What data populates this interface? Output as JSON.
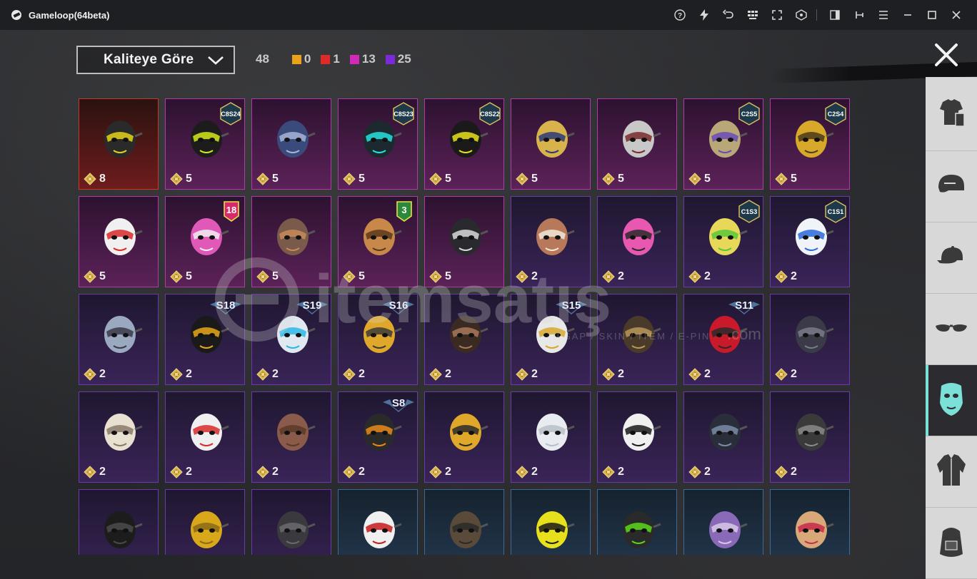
{
  "window": {
    "title": "Gameloop(64beta)"
  },
  "titlebar_icons": [
    "help-icon",
    "flash-icon",
    "undo-icon",
    "keyboard-icon",
    "fullscreen-icon",
    "gyro-icon",
    "sidebar-toggle-icon",
    "pin-icon",
    "menu-icon",
    "minimize-icon",
    "maximize-icon",
    "close-window-icon"
  ],
  "toolbar": {
    "sort_label": "Kaliteye Göre",
    "total_count": "48",
    "counts": [
      {
        "value": "0",
        "color": "#e9a21a"
      },
      {
        "value": "1",
        "color": "#e02a2a"
      },
      {
        "value": "13",
        "color": "#d12ab8"
      },
      {
        "value": "25",
        "color": "#7a2ad8"
      }
    ]
  },
  "colors": {
    "accent": "#7ae0d8",
    "legendary": "#e9a21a",
    "mythic": "#e02a2a",
    "epic": "#d12ab8",
    "rare": "#7a2ad8"
  },
  "sidebar": {
    "tabs": [
      {
        "name": "outfit-icon",
        "active": false
      },
      {
        "name": "helmet-icon",
        "active": false
      },
      {
        "name": "cap-icon",
        "active": false
      },
      {
        "name": "glasses-icon",
        "active": false
      },
      {
        "name": "mask-icon",
        "active": true
      },
      {
        "name": "jacket-icon",
        "active": false
      },
      {
        "name": "backpack-icon",
        "active": false
      }
    ]
  },
  "watermark": {
    "text": "itemsatış",
    "subtext": "HESAP / SKIN / ITEM / E-PIN",
    "suffix": ".com"
  },
  "items": [
    {
      "cost": "8",
      "rarity": "orange",
      "badge": "",
      "mask": "#2a2a2a",
      "accent": "#e8d21a"
    },
    {
      "cost": "5",
      "rarity": "magenta",
      "badge": "C8S24",
      "mask": "#1c1c1c",
      "accent": "#d4e81a"
    },
    {
      "cost": "5",
      "rarity": "magenta",
      "badge": "",
      "mask": "#3a4a7a",
      "accent": "#a8b4d8"
    },
    {
      "cost": "5",
      "rarity": "magenta",
      "badge": "C8S23",
      "mask": "#1c2a30",
      "accent": "#27e0e0"
    },
    {
      "cost": "5",
      "rarity": "magenta",
      "badge": "C8S22",
      "mask": "#1a1a1a",
      "accent": "#e8e01a"
    },
    {
      "cost": "5",
      "rarity": "magenta",
      "badge": "",
      "mask": "#d8b24a",
      "accent": "#2a3a7a"
    },
    {
      "cost": "5",
      "rarity": "magenta",
      "badge": "",
      "mask": "#c8c8c8",
      "accent": "#7a2a2a"
    },
    {
      "cost": "5",
      "rarity": "magenta",
      "badge": "C2S5",
      "mask": "#b8a878",
      "accent": "#6a4ab8"
    },
    {
      "cost": "5",
      "rarity": "magenta",
      "badge": "C2S4",
      "mask": "#d8a82a",
      "accent": "#4a3a1a"
    },
    {
      "cost": "5",
      "rarity": "magenta",
      "badge": "",
      "mask": "#f0f0f0",
      "accent": "#d82a2a"
    },
    {
      "cost": "5",
      "rarity": "magenta",
      "badge": "18",
      "mask": "#e058b8",
      "accent": "#f0f0f0"
    },
    {
      "cost": "5",
      "rarity": "magenta",
      "badge": "",
      "mask": "#7a5a4a",
      "accent": "#c88a5a"
    },
    {
      "cost": "5",
      "rarity": "magenta",
      "badge": "3",
      "mask": "#c8884a",
      "accent": "#5a3a1a"
    },
    {
      "cost": "5",
      "rarity": "magenta",
      "badge": "",
      "mask": "#2a2a2e",
      "accent": "#d8d8d8"
    },
    {
      "cost": "2",
      "rarity": "purple",
      "badge": "",
      "mask": "#b8785a",
      "accent": "#f0e8d8"
    },
    {
      "cost": "2",
      "rarity": "purple",
      "badge": "",
      "mask": "#e858b0",
      "accent": "#2a2a2a"
    },
    {
      "cost": "2",
      "rarity": "purple",
      "badge": "C1S3",
      "mask": "#e8d85a",
      "accent": "#5ac83a"
    },
    {
      "cost": "2",
      "rarity": "purple",
      "badge": "C1S1",
      "mask": "#f0f4f8",
      "accent": "#2a6ad8"
    },
    {
      "cost": "2",
      "rarity": "purple",
      "badge": "",
      "mask": "#9aa8c0",
      "accent": "#3a3a4a"
    },
    {
      "cost": "2",
      "rarity": "purple",
      "badge": "S18",
      "mask": "#1a1a1a",
      "accent": "#e8a81a"
    },
    {
      "cost": "2",
      "rarity": "purple",
      "badge": "S19",
      "mask": "#e0e8f0",
      "accent": "#2ab8e8"
    },
    {
      "cost": "2",
      "rarity": "purple",
      "badge": "S16",
      "mask": "#e0a82a",
      "accent": "#3a3a3a"
    },
    {
      "cost": "2",
      "rarity": "purple",
      "badge": "",
      "mask": "#3a2a22",
      "accent": "#a8785a"
    },
    {
      "cost": "2",
      "rarity": "purple",
      "badge": "S15",
      "mask": "#e8e8e8",
      "accent": "#d8a82a"
    },
    {
      "cost": "2",
      "rarity": "purple",
      "badge": "",
      "mask": "#4a3a2a",
      "accent": "#b8985a"
    },
    {
      "cost": "2",
      "rarity": "purple",
      "badge": "S11",
      "mask": "#c81a2a",
      "accent": "#2a2a2a"
    },
    {
      "cost": "2",
      "rarity": "purple",
      "badge": "",
      "mask": "#3a3a48",
      "accent": "#7a7a8a"
    },
    {
      "cost": "2",
      "rarity": "purple",
      "badge": "",
      "mask": "#e8e0d0",
      "accent": "#8a7a6a"
    },
    {
      "cost": "2",
      "rarity": "purple",
      "badge": "",
      "mask": "#f0f0f0",
      "accent": "#d82a2a"
    },
    {
      "cost": "2",
      "rarity": "purple",
      "badge": "",
      "mask": "#8a5a4a",
      "accent": "#5a3a2a"
    },
    {
      "cost": "2",
      "rarity": "purple",
      "badge": "S8",
      "mask": "#2a2a2a",
      "accent": "#e8881a"
    },
    {
      "cost": "2",
      "rarity": "purple",
      "badge": "",
      "mask": "#e0a82a",
      "accent": "#2a2a2a"
    },
    {
      "cost": "2",
      "rarity": "purple",
      "badge": "",
      "mask": "#e8ecf0",
      "accent": "#b8c0c8"
    },
    {
      "cost": "2",
      "rarity": "purple",
      "badge": "",
      "mask": "#f0f0f0",
      "accent": "#1a1a1a"
    },
    {
      "cost": "2",
      "rarity": "purple",
      "badge": "",
      "mask": "#2a2e3a",
      "accent": "#7a8aa8"
    },
    {
      "cost": "2",
      "rarity": "purple",
      "badge": "",
      "mask": "#3a3a3a",
      "accent": "#8a8a8a"
    },
    {
      "cost": "",
      "rarity": "purple",
      "badge": "",
      "mask": "#1c1c1c",
      "accent": "#4a4a4a"
    },
    {
      "cost": "",
      "rarity": "purple",
      "badge": "",
      "mask": "#d8a81a",
      "accent": "#8a6a1a"
    },
    {
      "cost": "",
      "rarity": "purple",
      "badge": "",
      "mask": "#3a3a3e",
      "accent": "#6a6a6e"
    },
    {
      "cost": "",
      "rarity": "blue",
      "badge": "",
      "mask": "#f0f0f0",
      "accent": "#c81a1a"
    },
    {
      "cost": "",
      "rarity": "blue",
      "badge": "",
      "mask": "#5a4a3a",
      "accent": "#2a2a2a"
    },
    {
      "cost": "",
      "rarity": "blue",
      "badge": "",
      "mask": "#e8e01a",
      "accent": "#1a1a1a"
    },
    {
      "cost": "",
      "rarity": "blue",
      "badge": "",
      "mask": "#2a2a2a",
      "accent": "#5ad81a"
    },
    {
      "cost": "",
      "rarity": "blue",
      "badge": "",
      "mask": "#8a6ab8",
      "accent": "#d8c8e8"
    },
    {
      "cost": "",
      "rarity": "blue",
      "badge": "",
      "mask": "#d8a878",
      "accent": "#c82a4a"
    }
  ]
}
